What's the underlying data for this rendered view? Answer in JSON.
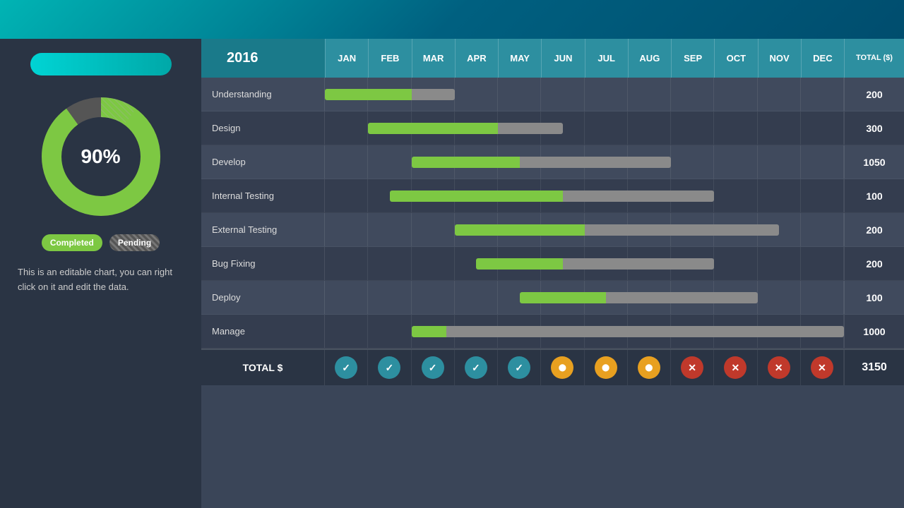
{
  "topBar": {
    "visible": true
  },
  "leftPanel": {
    "progressBar": "progress-bar",
    "percentage": "90%",
    "legend": {
      "completed": "Completed",
      "pending": "Pending"
    },
    "description": "This is an editable chart, you can right click on it and edit the data."
  },
  "chart": {
    "year": "2016",
    "months": [
      "JAN",
      "FEB",
      "MAR",
      "APR",
      "MAY",
      "JUN",
      "JUL",
      "AUG",
      "SEP",
      "OCT",
      "NOV",
      "DEC"
    ],
    "totalHeader": "TOTAL ($)",
    "rows": [
      {
        "label": "Understanding",
        "total": "200",
        "barStart": 0,
        "greenWidth": 2,
        "grayWidth": 1
      },
      {
        "label": "Design",
        "total": "300",
        "barStart": 1,
        "greenWidth": 3,
        "grayWidth": 1.5
      },
      {
        "label": "Develop",
        "total": "1050",
        "barStart": 2,
        "greenWidth": 2.5,
        "grayWidth": 3.5
      },
      {
        "label": "Internal Testing",
        "total": "100",
        "barStart": 1.5,
        "greenWidth": 4,
        "grayWidth": 3.5
      },
      {
        "label": "External Testing",
        "total": "200",
        "barStart": 3,
        "greenWidth": 3,
        "grayWidth": 4.5
      },
      {
        "label": "Bug Fixing",
        "total": "200",
        "barStart": 3.5,
        "greenWidth": 2,
        "grayWidth": 3.5
      },
      {
        "label": "Deploy",
        "total": "100",
        "barStart": 4.5,
        "greenWidth": 2,
        "grayWidth": 3.5
      },
      {
        "label": "Manage",
        "total": "1000",
        "barStart": 2,
        "greenWidth": 0.8,
        "grayWidth": 9.2
      }
    ],
    "totalRow": {
      "label": "TOTAL $",
      "total": "3150",
      "icons": [
        "check",
        "check",
        "check",
        "check",
        "check",
        "circle",
        "circle",
        "circle",
        "x",
        "x",
        "x",
        "x"
      ]
    }
  }
}
